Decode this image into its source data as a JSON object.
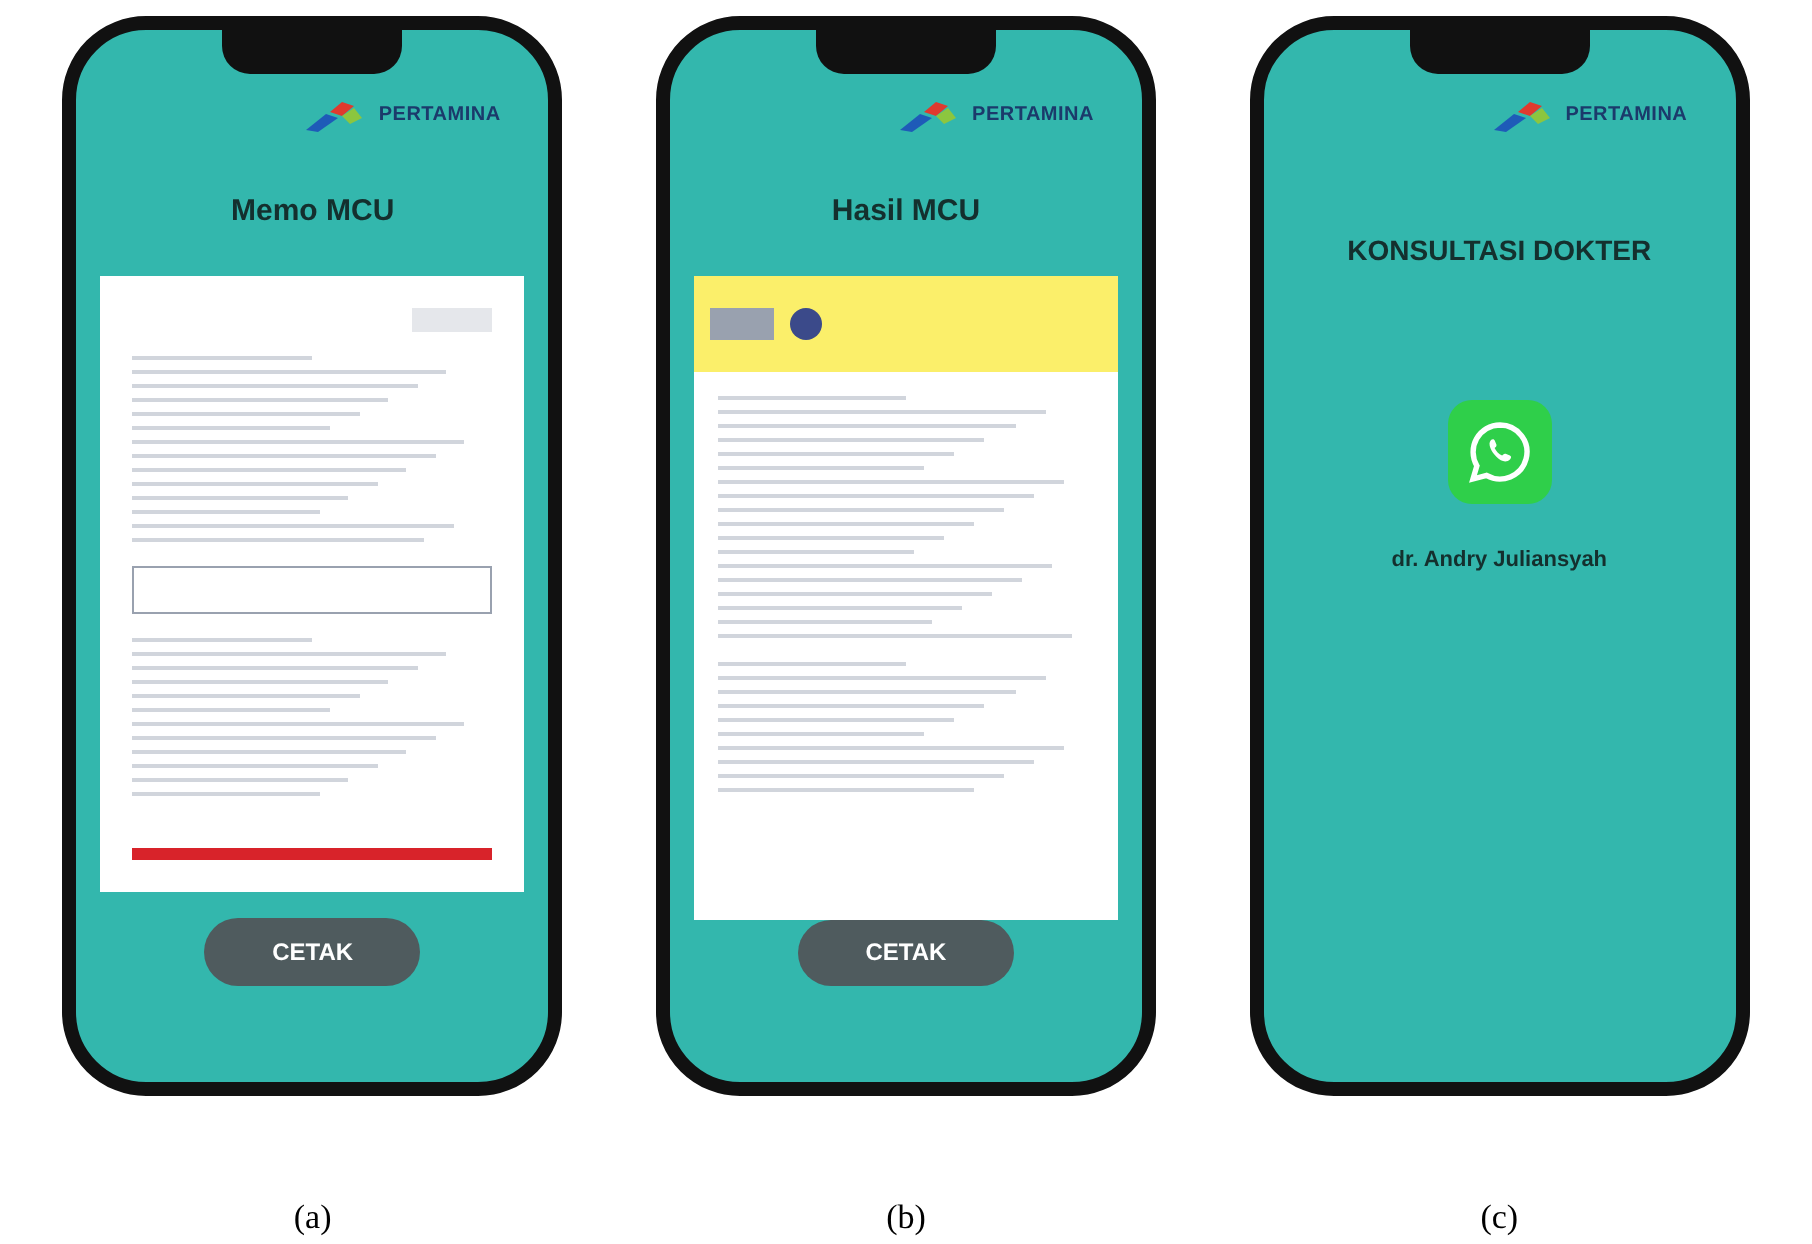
{
  "phones": [
    {
      "kind": "memo",
      "logo": "PERTAMINA",
      "title": "Memo MCU",
      "button": "CETAK",
      "caption": "(a)"
    },
    {
      "kind": "lab",
      "logo": "PERTAMINA",
      "title": "Hasil MCU",
      "button": "CETAK",
      "caption": "(b)"
    },
    {
      "kind": "contact",
      "logo": "PERTAMINA",
      "title": "KONSULTASI DOKTER",
      "contact": "dr. Andry Juliansyah",
      "caption": "(c)"
    }
  ]
}
